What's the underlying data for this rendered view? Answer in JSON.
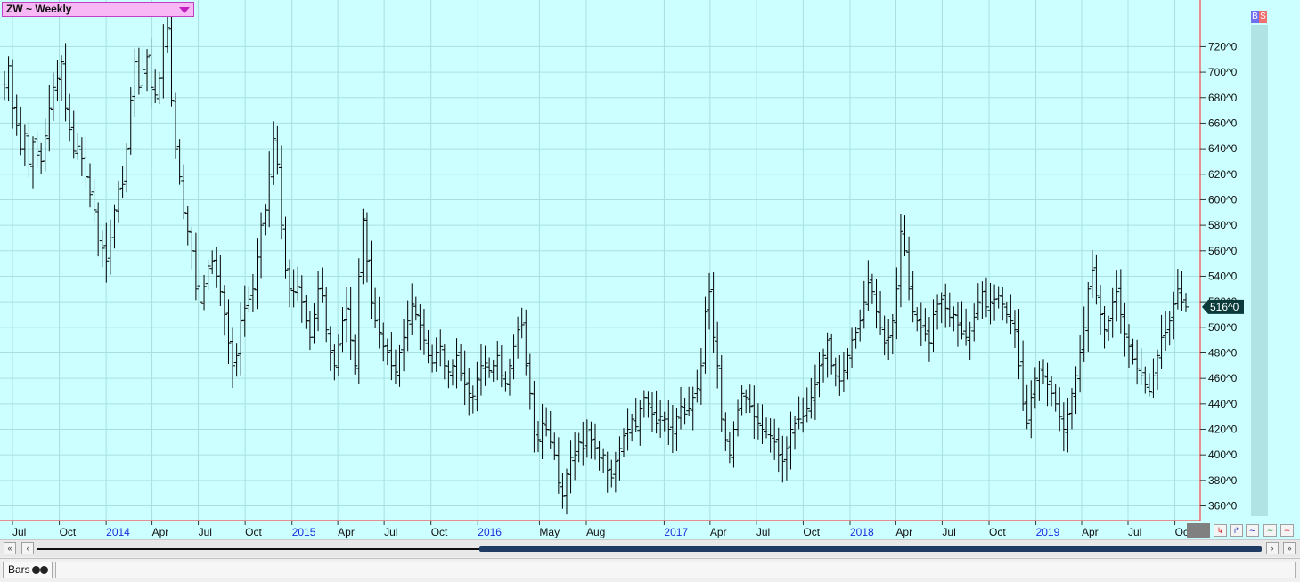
{
  "symbol_selector": {
    "label": "ZW ~ Weekly"
  },
  "buttons": {
    "buy": "B",
    "sell": "S"
  },
  "bottom": {
    "tab_label": "Bars"
  },
  "colors": {
    "plot_bg": "#ccffff",
    "grid": "#a8e0e0",
    "bar": "#000000",
    "axis_red": "#ff2020",
    "last_price_bg": "#0a3a3a",
    "year_label": "#1a2ee0"
  },
  "chart_data": {
    "type": "ohlc",
    "title": "",
    "xlabel": "",
    "ylabel": "",
    "ylim": [
      352,
      744
    ],
    "y_ticks": [
      {
        "v": 720,
        "label": "720^0"
      },
      {
        "v": 700,
        "label": "700^0"
      },
      {
        "v": 680,
        "label": "680^0"
      },
      {
        "v": 660,
        "label": "660^0"
      },
      {
        "v": 640,
        "label": "640^0"
      },
      {
        "v": 620,
        "label": "620^0"
      },
      {
        "v": 600,
        "label": "600^0"
      },
      {
        "v": 580,
        "label": "580^0"
      },
      {
        "v": 560,
        "label": "560^0"
      },
      {
        "v": 540,
        "label": "540^0"
      },
      {
        "v": 520,
        "label": "520^0"
      },
      {
        "v": 500,
        "label": "500^0"
      },
      {
        "v": 480,
        "label": "480^0"
      },
      {
        "v": 460,
        "label": "460^0"
      },
      {
        "v": 440,
        "label": "440^0"
      },
      {
        "v": 420,
        "label": "420^0"
      },
      {
        "v": 400,
        "label": "400^0"
      },
      {
        "v": 380,
        "label": "380^0"
      },
      {
        "v": 360,
        "label": "360^0"
      }
    ],
    "x_ticks": [
      {
        "date": "2013-07-01",
        "label": "Jul",
        "year": false
      },
      {
        "date": "2013-10-01",
        "label": "Oct",
        "year": false
      },
      {
        "date": "2014-01-01",
        "label": "2014",
        "year": true
      },
      {
        "date": "2014-04-01",
        "label": "Apr",
        "year": false
      },
      {
        "date": "2014-07-01",
        "label": "Jul",
        "year": false
      },
      {
        "date": "2014-10-01",
        "label": "Oct",
        "year": false
      },
      {
        "date": "2015-01-01",
        "label": "2015",
        "year": true
      },
      {
        "date": "2015-04-01",
        "label": "Apr",
        "year": false
      },
      {
        "date": "2015-07-01",
        "label": "Jul",
        "year": false
      },
      {
        "date": "2015-10-01",
        "label": "Oct",
        "year": false
      },
      {
        "date": "2016-01-01",
        "label": "2016",
        "year": true
      },
      {
        "date": "2016-05-01",
        "label": "May",
        "year": false
      },
      {
        "date": "2016-08-01",
        "label": "Aug",
        "year": false
      },
      {
        "date": "2017-01-01",
        "label": "2017",
        "year": true
      },
      {
        "date": "2017-04-01",
        "label": "Apr",
        "year": false
      },
      {
        "date": "2017-07-01",
        "label": "Jul",
        "year": false
      },
      {
        "date": "2017-10-01",
        "label": "Oct",
        "year": false
      },
      {
        "date": "2018-01-01",
        "label": "2018",
        "year": true
      },
      {
        "date": "2018-04-01",
        "label": "Apr",
        "year": false
      },
      {
        "date": "2018-07-01",
        "label": "Jul",
        "year": false
      },
      {
        "date": "2018-10-01",
        "label": "Oct",
        "year": false
      },
      {
        "date": "2019-01-01",
        "label": "2019",
        "year": true
      },
      {
        "date": "2019-04-01",
        "label": "Apr",
        "year": false
      },
      {
        "date": "2019-07-01",
        "label": "Jul",
        "year": false
      },
      {
        "date": "2019-10-01",
        "label": "Oct",
        "year": false
      }
    ],
    "grid": true,
    "last_price": {
      "value": 516,
      "label": "516^0"
    },
    "series_closes": [
      [
        690,
        705,
        672,
        658,
        640,
        652,
        628,
        645,
        635,
        630,
        650,
        672,
        688,
        695,
        708,
        672,
        655,
        638,
        642,
        632,
        618,
        604,
        592,
        570,
        562,
        552,
        570,
        592,
        608,
        612,
        640,
        678,
        708,
        688,
        702,
        712,
        688,
        682,
        695,
        722,
        735,
        678,
        640,
        618,
        590,
        575,
        560,
        530,
        520,
        532,
        548,
        552,
        540,
        528,
        510,
        488,
        470,
        478,
        505,
        515,
        522,
        530,
        555,
        580,
        592,
        620,
        648,
        628,
        580,
        545,
        530,
        528,
        532,
        520,
        505,
        492,
        510,
        530,
        525,
        498,
        480,
        470,
        486,
        505,
        515,
        490,
        470,
        540,
        585,
        552,
        520,
        505,
        496,
        485,
        480,
        470,
        465,
        480,
        492,
        505,
        518,
        510,
        500,
        490,
        478,
        472,
        480,
        485,
        470,
        465,
        470,
        478,
        462,
        455,
        448,
        446,
        460,
        470,
        472,
        466,
        470,
        478,
        462,
        456,
        470,
        485,
        498,
        502,
        470,
        448,
        418,
        412,
        425,
        420,
        410,
        400,
        378,
        368,
        385,
        398,
        400,
        410,
        405,
        418,
        412,
        405,
        398,
        400,
        388,
        382,
        395,
        405,
        415,
        420,
        428,
        422,
        436,
        445,
        440,
        432,
        425,
        430,
        428,
        420,
        418,
        430,
        438,
        432,
        436,
        445,
        452,
        470,
        512,
        528,
        492,
        470,
        428,
        412,
        400,
        420,
        435,
        448,
        445,
        438,
        430,
        425,
        420,
        418,
        415,
        410,
        400,
        395,
        405,
        420,
        425,
        428,
        430,
        436,
        445,
        455,
        470,
        478,
        490,
        470,
        462,
        458,
        466,
        478,
        490,
        496,
        505,
        520,
        535,
        528,
        512,
        500,
        488,
        492,
        505,
        530,
        575,
        560,
        530,
        512,
        505,
        500,
        495,
        488,
        510,
        518,
        522,
        515,
        508,
        510,
        502,
        495,
        492,
        500,
        508,
        520,
        528,
        516,
        520,
        522,
        525,
        518,
        510,
        505,
        498,
        470,
        440,
        425,
        445,
        460,
        468,
        462,
        455,
        448,
        440,
        430,
        420,
        432,
        448,
        462,
        480,
        500,
        530,
        545,
        525,
        510,
        498,
        505,
        520,
        528,
        510,
        495,
        485,
        475,
        468,
        462,
        455,
        450,
        462,
        478,
        492,
        496,
        505,
        518,
        530,
        520,
        516
      ]
    ]
  }
}
